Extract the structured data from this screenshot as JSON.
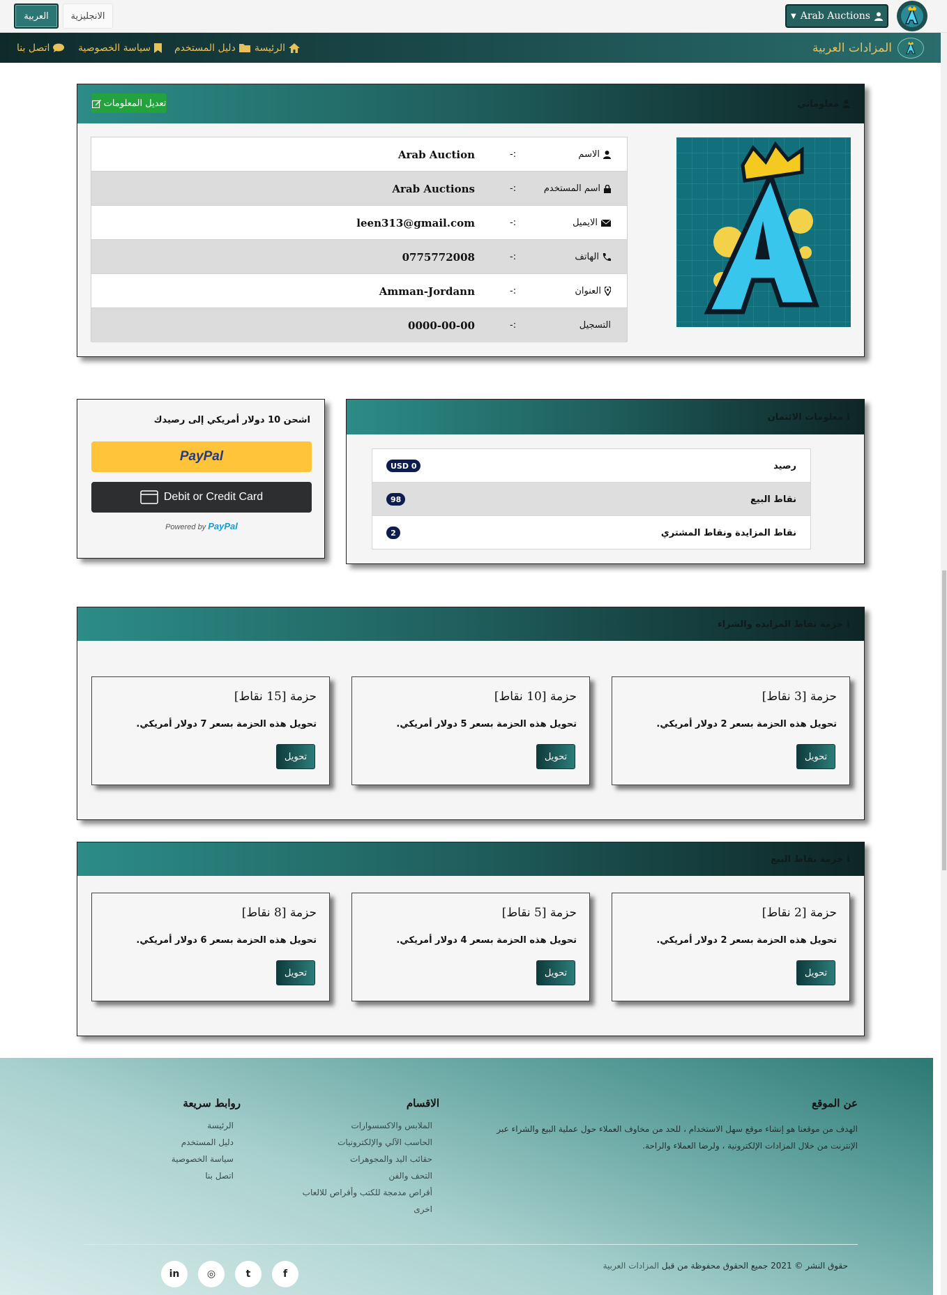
{
  "topbar": {
    "lang_arabic": "العربية",
    "lang_english": "الانجليزية",
    "user_menu": "Arab Auctions"
  },
  "nav": {
    "brand": "المزادات العربية",
    "items": [
      {
        "label": "الرئيسة",
        "icon": "home-icon"
      },
      {
        "label": "دليل المستخدم",
        "icon": "folder-icon"
      },
      {
        "label": "سياسة الخصوصية",
        "icon": "bookmark-icon"
      },
      {
        "label": "اتصل بنا",
        "icon": "comment-icon"
      }
    ]
  },
  "profile": {
    "title": "معلوماتي",
    "edit_label": "تعديل المعلومات",
    "separator": "-:",
    "rows": [
      {
        "label": "الاسم",
        "value": "Arab Auction",
        "icon": "user-icon"
      },
      {
        "label": "اسم المستخدم",
        "value": "Arab Auctions",
        "icon": "lock-icon"
      },
      {
        "label": "الايميل",
        "value": "leen313@gmail.com",
        "icon": "envelope-icon"
      },
      {
        "label": "الهاتف",
        "value": "0775772008",
        "icon": "phone-icon"
      },
      {
        "label": "العنوان",
        "value": "Amman-Jordann",
        "icon": "map-marker-icon"
      },
      {
        "label": "التسجيل",
        "value": "0000-00-00",
        "icon": ""
      }
    ]
  },
  "credit": {
    "title": "معلومات الائتمان",
    "rows": [
      {
        "label": "رصيد",
        "badge": "USD 0"
      },
      {
        "label": "نقاط البيع",
        "badge": "98"
      },
      {
        "label": "نقاط المزايدة ونقاط المشتري",
        "badge": "2"
      }
    ]
  },
  "paypal": {
    "heading": "اشحن 10 دولار أمريكي إلى رصيدك",
    "paypal_label": "PayPal",
    "card_label": "Debit or Credit Card",
    "powered_by": "Powered by",
    "powered_brand": "PayPal"
  },
  "bid_packages": {
    "title": "حزمة نقاط المزايده والشراء",
    "items": [
      {
        "title": "حزمة [3 نقاط]",
        "desc": "تحويل هذه الحزمة بسعر 2 دولار أمريكي.",
        "button": "تحويل"
      },
      {
        "title": "حزمة [10 نقاط]",
        "desc": "تحويل هذه الحزمة بسعر 5 دولار أمريكي.",
        "button": "تحويل"
      },
      {
        "title": "حزمة [15 نقاط]",
        "desc": "تحويل هذه الحزمة بسعر 7 دولار أمريكي.",
        "button": "تحويل"
      }
    ]
  },
  "sell_packages": {
    "title": "حزمة نقاط البيع",
    "items": [
      {
        "title": "حزمة [2 نقاط]",
        "desc": "تحويل هذه الحزمة بسعر 2 دولار أمريكي.",
        "button": "تحويل"
      },
      {
        "title": "حزمة [5 نقاط]",
        "desc": "تحويل هذه الحزمة بسعر 4 دولار أمريكي.",
        "button": "تحويل"
      },
      {
        "title": "حزمة [8 نقاط]",
        "desc": "تحويل هذه الحزمة بسعر 6 دولار أمريكي.",
        "button": "تحويل"
      }
    ]
  },
  "footer": {
    "about_title": "عن الموقع",
    "about_text": "الهدف من موقعنا هو إنشاء موقع سهل الاستخدام ، للحد من مخاوف العملاء حول عملية البيع والشراء عبر الإنترنت من خلال المزادات الإلكترونية ، ولرضا العملاء والراحة.",
    "categories_title": "الاقسام",
    "categories": [
      "الملابس والاكسسوارات",
      "الحاسب الآلي والإلكترونيات",
      "حقائب اليد والمجوهرات",
      "التحف والفن",
      "أقراص مدمجة للكتب وأقراص للالعاب",
      "اخرى"
    ],
    "quick_title": "روابط سريعة",
    "quick_links": [
      "الرئيسة",
      "دليل المستخدم",
      "سياسة الخصوصية",
      "اتصل بنا"
    ],
    "copyright_prefix": "حقوق النشر © 2021 جميع الحقوق محفوظة من قبل",
    "copyright_brand": "المزادات العربية",
    "social": [
      {
        "label": "f",
        "icon": "facebook-icon"
      },
      {
        "label": "t",
        "icon": "twitter-icon"
      },
      {
        "label": "◎",
        "icon": "instagram-icon"
      },
      {
        "label": "in",
        "icon": "linkedin-icon"
      }
    ]
  },
  "colors": {
    "teal_dark": "#0f2a2b",
    "teal": "#2c7673",
    "gold": "#e8c15a",
    "green_btn": "#23a23e",
    "paypal_yellow": "#ffc439",
    "badge_navy": "#0e1d4d"
  }
}
